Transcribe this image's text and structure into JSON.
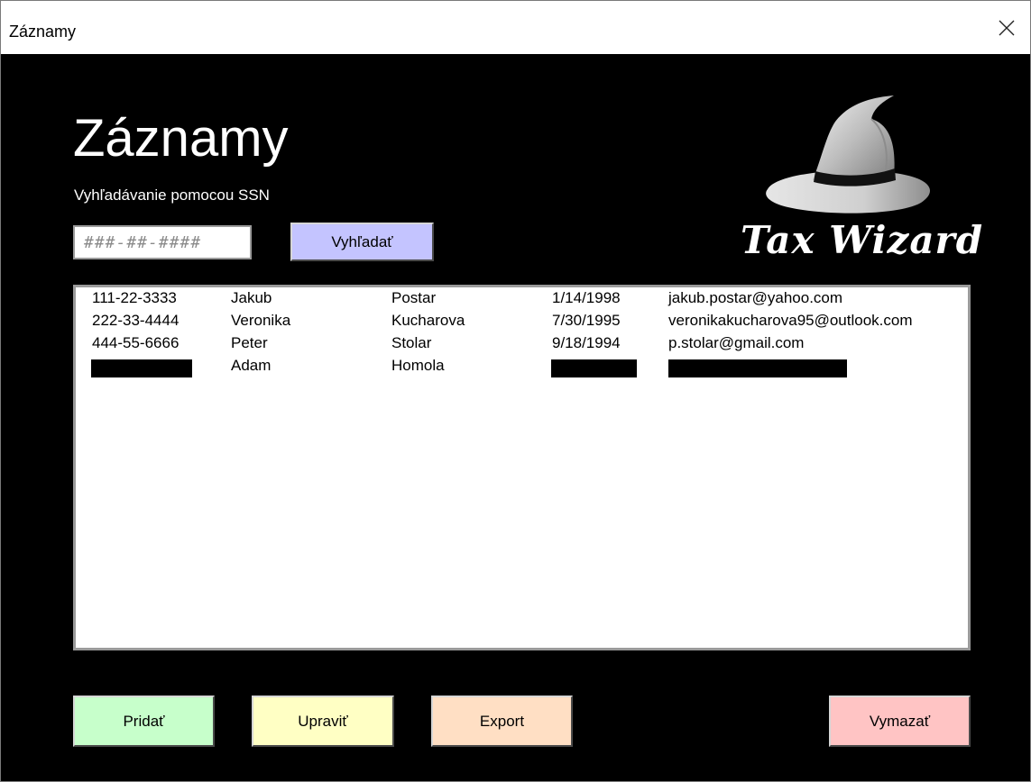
{
  "window": {
    "title": "Záznamy",
    "close_icon": "close-icon"
  },
  "header": {
    "title": "Záznamy",
    "search_label": "Vyhľadávanie pomocou SSN",
    "ssn_placeholder": "###-##-####",
    "search_button": "Vyhľadať"
  },
  "logo": {
    "text": "Tax Wizard",
    "icon": "wizard-hat-icon"
  },
  "records": [
    {
      "ssn": "111-22-3333",
      "first": "Jakub",
      "last": "Postar",
      "dob": "1/14/1998",
      "email": "jakub.postar@yahoo.com"
    },
    {
      "ssn": "222-33-4444",
      "first": "Veronika",
      "last": "Kucharova",
      "dob": "7/30/1995",
      "email": "veronikakucharova95@outlook.com"
    },
    {
      "ssn": "444-55-6666",
      "first": "Peter",
      "last": "Stolar",
      "dob": "9/18/1994",
      "email": "p.stolar@gmail.com"
    },
    {
      "ssn": "",
      "first": "Adam",
      "last": "Homola",
      "dob": "",
      "email": "",
      "redacted": true
    }
  ],
  "actions": {
    "add": "Pridať",
    "edit": "Upraviť",
    "export": "Export",
    "delete": "Vymazať"
  },
  "colors": {
    "background": "#000000",
    "search_button": "#c4c4ff",
    "add_button": "#c7ffcb",
    "edit_button": "#ffffc4",
    "export_button": "#ffdfc4",
    "delete_button": "#ffc4c4"
  }
}
